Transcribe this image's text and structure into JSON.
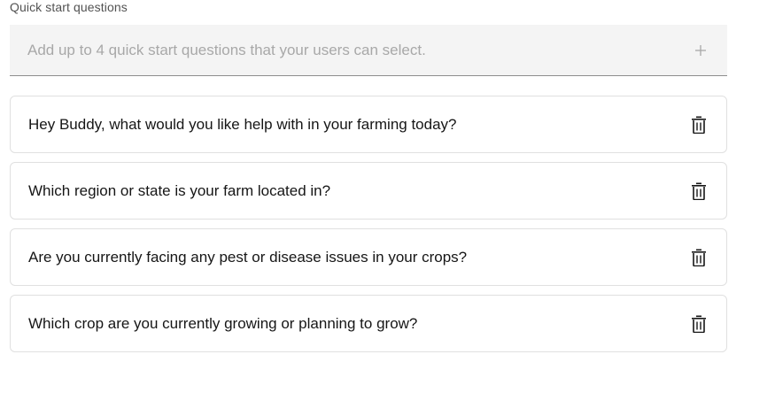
{
  "section": {
    "label": "Quick start questions"
  },
  "add_field": {
    "placeholder": "Add up to 4 quick start questions that your users can select.",
    "value": "",
    "add_icon": "plus-icon"
  },
  "questions": [
    {
      "text": "Hey Buddy, what would you like help with in your farming today?",
      "delete_icon": "trash-icon"
    },
    {
      "text": "Which region or state is your farm located in?",
      "delete_icon": "trash-icon"
    },
    {
      "text": "Are you currently facing any pest or disease issues in your crops?",
      "delete_icon": "trash-icon"
    },
    {
      "text": "Which crop are you currently growing or planning to grow?",
      "delete_icon": "trash-icon"
    }
  ],
  "colors": {
    "field_bg": "#f4f4f4",
    "field_underline": "#8d8d8d",
    "card_border": "#e0e0e0",
    "text": "#161616",
    "label": "#525252",
    "placeholder": "#a8a8a8",
    "icon": "#161616",
    "plus_icon": "#a8a8a8"
  }
}
